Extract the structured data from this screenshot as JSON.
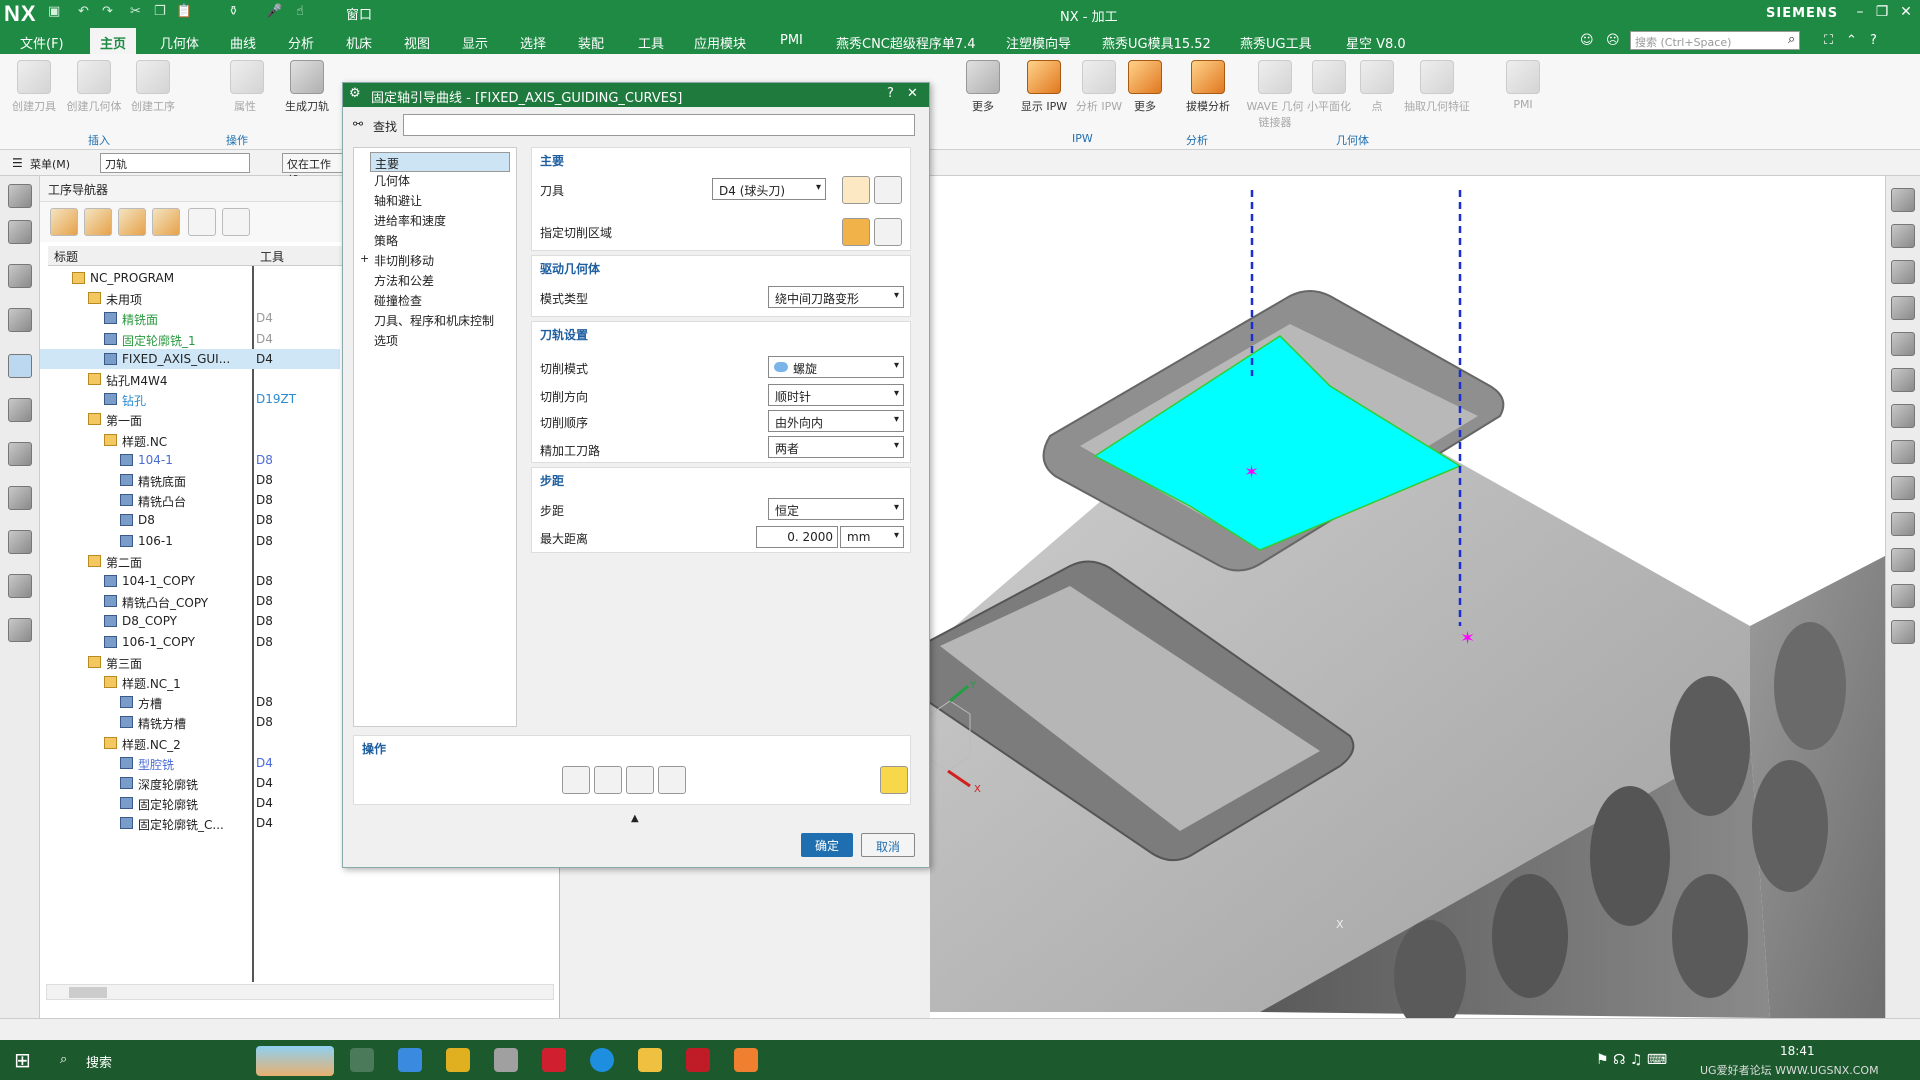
{
  "window": {
    "logo": "NX",
    "title": "NX - 加工",
    "brand": "SIEMENS"
  },
  "menubar": {
    "file": "文件(F)",
    "items": [
      "主页",
      "几何体",
      "曲线",
      "分析",
      "机床",
      "视图",
      "显示",
      "选择",
      "装配",
      "工具",
      "应用模块",
      "PMI",
      "燕秀CNC超级程序单7.4",
      "注塑模向导",
      "燕秀UG模具15.52",
      "燕秀UG工具",
      "星空 V8.0"
    ],
    "window_menu": "窗口",
    "search_placeholder": "搜索 (Ctrl+Space)"
  },
  "ribbon": {
    "buttons": [
      "创建刀具",
      "创建几何体",
      "创建工序",
      "属性",
      "生成刀轨",
      "显示 IPW",
      "分析 IPW",
      "更多",
      "更多",
      "拔模分析",
      "WAVE 几何链接器",
      "小平面化",
      "点",
      "抽取几何特征",
      "PMI"
    ],
    "groups": [
      "插入",
      "操作",
      "IPW",
      "分析",
      "几何体"
    ]
  },
  "filterrow": {
    "menu": "菜单(M)",
    "filter_value": "刀轨",
    "scope": "仅在工作部"
  },
  "navigator": {
    "title": "工序导航器",
    "col_title": "标题",
    "col_tool": "工具",
    "rows": [
      {
        "name": "NC_PROGRAM",
        "tool": ""
      },
      {
        "name": "未用项",
        "tool": ""
      },
      {
        "name": "精铣面",
        "tool": "D4"
      },
      {
        "name": "固定轮廓铣_1",
        "tool": "D4"
      },
      {
        "name": "FIXED_AXIS_GUI...",
        "tool": "D4"
      },
      {
        "name": "钻孔M4W4",
        "tool": ""
      },
      {
        "name": "钻孔",
        "tool": "D19ZT"
      },
      {
        "name": "第一面",
        "tool": ""
      },
      {
        "name": "样题.NC",
        "tool": ""
      },
      {
        "name": "104-1",
        "tool": "D8"
      },
      {
        "name": "精铣底面",
        "tool": "D8"
      },
      {
        "name": "精铣凸台",
        "tool": "D8"
      },
      {
        "name": "D8",
        "tool": "D8"
      },
      {
        "name": "106-1",
        "tool": "D8"
      },
      {
        "name": "第二面",
        "tool": ""
      },
      {
        "name": "104-1_COPY",
        "tool": "D8"
      },
      {
        "name": "精铣凸台_COPY",
        "tool": "D8"
      },
      {
        "name": "D8_COPY",
        "tool": "D8"
      },
      {
        "name": "106-1_COPY",
        "tool": "D8"
      },
      {
        "name": "第三面",
        "tool": ""
      },
      {
        "name": "样题.NC_1",
        "tool": ""
      },
      {
        "name": "方槽",
        "tool": "D8"
      },
      {
        "name": "精铣方槽",
        "tool": "D8"
      },
      {
        "name": "样题.NC_2",
        "tool": ""
      },
      {
        "name": "型腔铣",
        "tool": "D4"
      },
      {
        "name": "深度轮廓铣",
        "tool": "D4"
      },
      {
        "name": "固定轮廓铣",
        "tool": "D4"
      },
      {
        "name": "固定轮廓铣_C...",
        "tool": "D4"
      }
    ]
  },
  "dialog": {
    "title": "固定轴引导曲线 - [FIXED_AXIS_GUIDING_CURVES]",
    "help": "?",
    "close": "✕",
    "find_label": "查找",
    "tree": [
      "主要",
      "几何体",
      "轴和避让",
      "进给率和速度",
      "策略",
      "非切削移动",
      "方法和公差",
      "碰撞检查",
      "刀具、程序和机床控制",
      "选项"
    ],
    "main": {
      "header": "主要",
      "tool_label": "刀具",
      "tool_value": "D4 (球头刀)",
      "cut_area_label": "指定切削区域"
    },
    "drive": {
      "header": "驱动几何体",
      "mode_label": "模式类型",
      "mode_value": "绕中间刀路变形"
    },
    "path": {
      "header": "刀轨设置",
      "cut_mode_label": "切削模式",
      "cut_mode_value": "螺旋",
      "cut_dir_label": "切削方向",
      "cut_dir_value": "顺时针",
      "cut_order_label": "切削顺序",
      "cut_order_value": "由外向内",
      "finish_label": "精加工刀路",
      "finish_value": "两者"
    },
    "step": {
      "header": "步距",
      "step_label": "步距",
      "step_value": "恒定",
      "max_label": "最大距离",
      "max_value": "0. 2000",
      "unit": "mm"
    },
    "ops": {
      "header": "操作"
    },
    "ok": "确定",
    "cancel": "取消"
  },
  "viewport": {
    "axis_x": "X",
    "axis_y": "Y",
    "axis_x2": "X"
  },
  "taskbar": {
    "search": "搜索",
    "time": "18:41",
    "watermark": "UG爱好者论坛 WWW.UGSNX.COM"
  },
  "colors": {
    "titlebar": "#1f8a44",
    "accent": "#1f6fb0",
    "highlight": "#00ffff",
    "marker": "#ff00ff"
  }
}
